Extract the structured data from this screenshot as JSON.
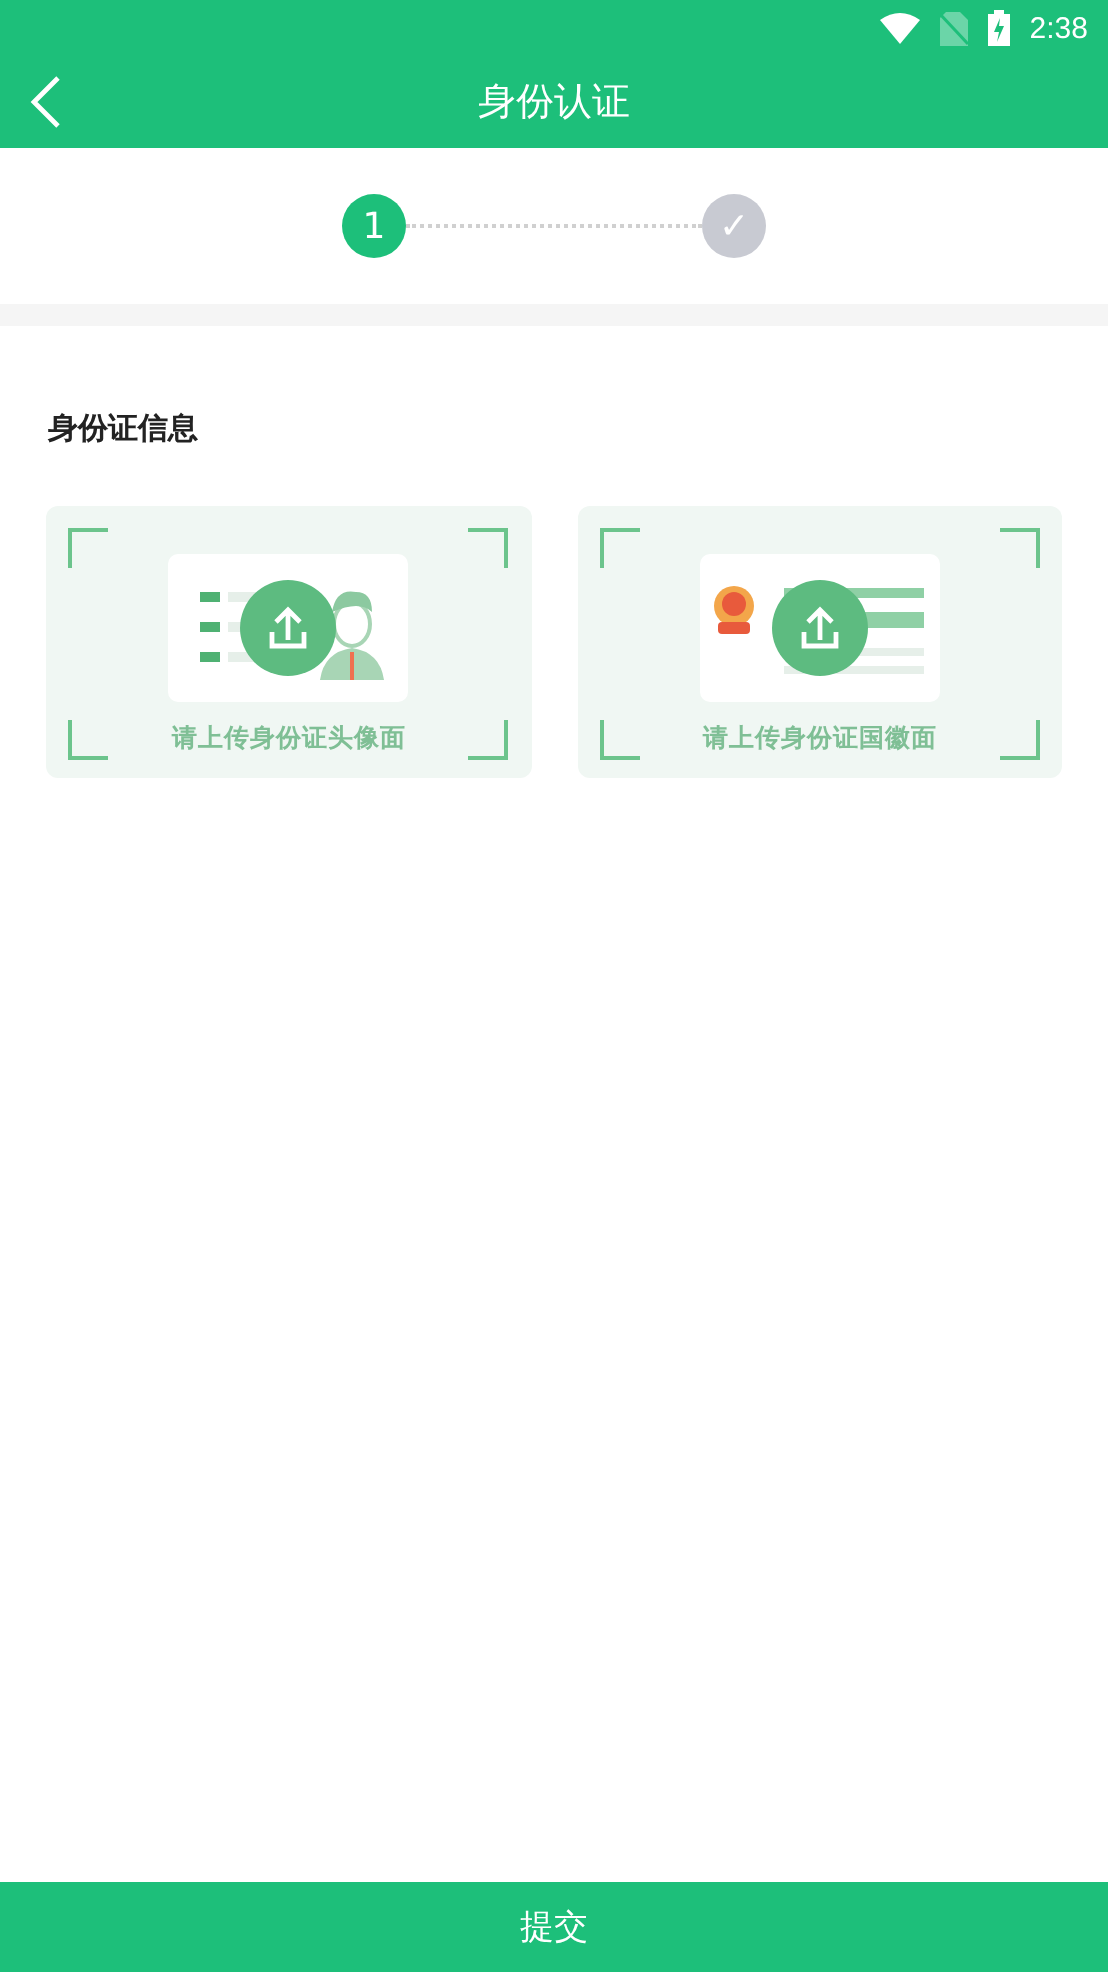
{
  "status_bar": {
    "time": "2:38"
  },
  "header": {
    "title": "身份认证"
  },
  "steps": [
    {
      "label": "1",
      "selected": true
    },
    {
      "label": "✓",
      "selected": false
    }
  ],
  "section": {
    "title": "身份证信息"
  },
  "uploads": [
    {
      "kind": "portrait",
      "caption": "请上传身份证头像面"
    },
    {
      "kind": "emblem",
      "caption": "请上传身份证国徽面"
    }
  ],
  "submit": {
    "label": "提交"
  }
}
